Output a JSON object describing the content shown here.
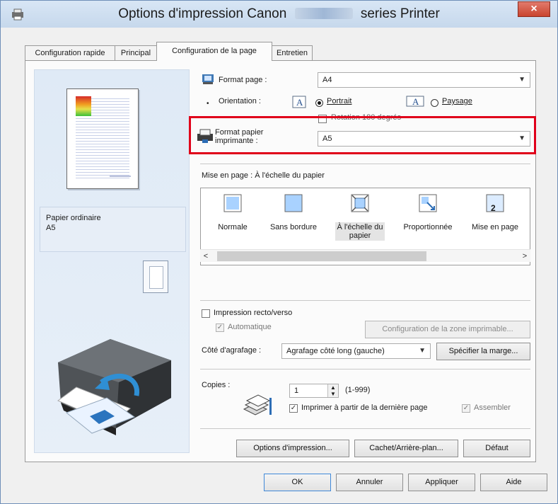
{
  "window": {
    "title_prefix": "Options d'impression Canon",
    "title_suffix": "series Printer",
    "close_symbol": "×"
  },
  "tabs": [
    {
      "label": "Configuration rapide"
    },
    {
      "label": "Principal"
    },
    {
      "label": "Configuration de la page"
    },
    {
      "label": "Entretien"
    }
  ],
  "preview": {
    "media_type": "Papier ordinaire",
    "media_size": "A5"
  },
  "page_setup": {
    "page_size_label": "Format page :",
    "page_size_value": "A4",
    "orientation_label": "Orientation :",
    "portrait_label": "Portrait",
    "landscape_label": "Paysage",
    "rotate_label": "Rotation 180 degrés",
    "printer_paper_label_line1": "Format papier",
    "printer_paper_label_line2": "imprimante :",
    "printer_paper_value": "A5",
    "layout_label": "Mise en page : À l'échelle du papier"
  },
  "layouts": [
    {
      "label": "Normale"
    },
    {
      "label": "Sans bordure"
    },
    {
      "label": "À l'échelle du papier",
      "line1": "À l'échelle du",
      "line2": "papier"
    },
    {
      "label": "Proportionnée"
    },
    {
      "label": "Mise en page",
      "icon_text": "2"
    }
  ],
  "duplex": {
    "duplex_label": "Impression recto/verso",
    "automatic_label": "Automatique",
    "print_area_button": "Configuration de la zone imprimable...",
    "staple_label": "Côté d'agrafage :",
    "staple_value": "Agrafage côté long (gauche)",
    "margin_button": "Spécifier la marge..."
  },
  "copies": {
    "label": "Copies :",
    "value": "1",
    "range": "(1-999)",
    "last_page_label": "Imprimer à partir de la dernière page",
    "collate_label": "Assembler"
  },
  "bottom_buttons": {
    "print_options": "Options d'impression...",
    "stamp_background": "Cachet/Arrière-plan...",
    "default": "Défaut"
  },
  "dialog_buttons": {
    "ok": "OK",
    "cancel": "Annuler",
    "apply": "Appliquer",
    "help": "Aide"
  },
  "colors": {
    "accent_red": "#e0001a",
    "titlebar": "#d1e1f3"
  }
}
